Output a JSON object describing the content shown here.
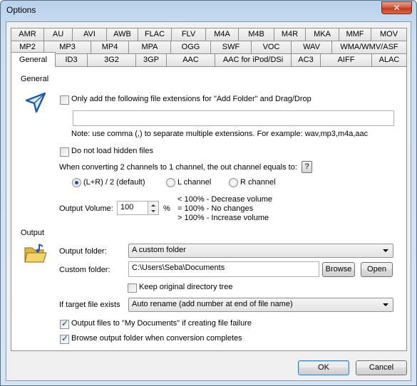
{
  "window": {
    "title": "Options",
    "close_glyph": "✕"
  },
  "tabs": {
    "row1": [
      "AMR",
      "AU",
      "AVI",
      "AWB",
      "FLAC",
      "FLV",
      "M4A",
      "M4B",
      "M4R",
      "MKA",
      "MMF",
      "MOV"
    ],
    "row2": [
      "MP2",
      "MP3",
      "MP4",
      "MPA",
      "OGG",
      "SWF",
      "VOC",
      "WAV",
      "WMA/WMV/ASF"
    ],
    "row3": [
      "General",
      "ID3",
      "3G2",
      "3GP",
      "AAC",
      "AAC for iPod/DSi",
      "AC3",
      "AIFF",
      "ALAC"
    ],
    "active": "General"
  },
  "general": {
    "section_label": "General",
    "add_folder_checkbox": {
      "label": "Only add the following file extensions for \"Add Folder\" and Drag/Drop",
      "checked": false
    },
    "extensions_value": "",
    "note": "Note: use comma (,) to separate multiple extensions. For example: wav,mp3,m4a,aac",
    "hidden_files_checkbox": {
      "label": "Do not load hidden files",
      "checked": false
    },
    "channel_question": "When converting 2 channels to 1 channel, the out channel equals to:",
    "help_label": "?",
    "radios": [
      {
        "label": "(L+R) / 2 (default)",
        "checked": true
      },
      {
        "label": "L channel",
        "checked": false
      },
      {
        "label": "R channel",
        "checked": false
      }
    ],
    "output_volume_label": "Output Volume:",
    "output_volume_value": "100",
    "percent_sign": "%",
    "volume_notes": [
      "< 100% - Decrease volume",
      "= 100% - No changes",
      "> 100% - Increase volume"
    ]
  },
  "output": {
    "section_label": "Output",
    "output_folder_label": "Output folder:",
    "output_folder_value": "A custom folder",
    "custom_folder_label": "Custom folder:",
    "custom_folder_value": "C:\\Users\\Seba\\Documents",
    "browse_label": "Browse",
    "open_label": "Open",
    "keep_dir_checkbox": {
      "label": "Keep original directory tree",
      "checked": false
    },
    "target_exists_label": "If target file exists",
    "target_exists_value": "Auto rename (add number at end of file name)",
    "my_documents_checkbox": {
      "label": "Output files to \"My Documents\" if creating file failure",
      "checked": true
    },
    "browse_output_checkbox": {
      "label": "Browse output folder when conversion completes",
      "checked": true
    }
  },
  "footer": {
    "ok_label": "OK",
    "cancel_label": "Cancel"
  }
}
